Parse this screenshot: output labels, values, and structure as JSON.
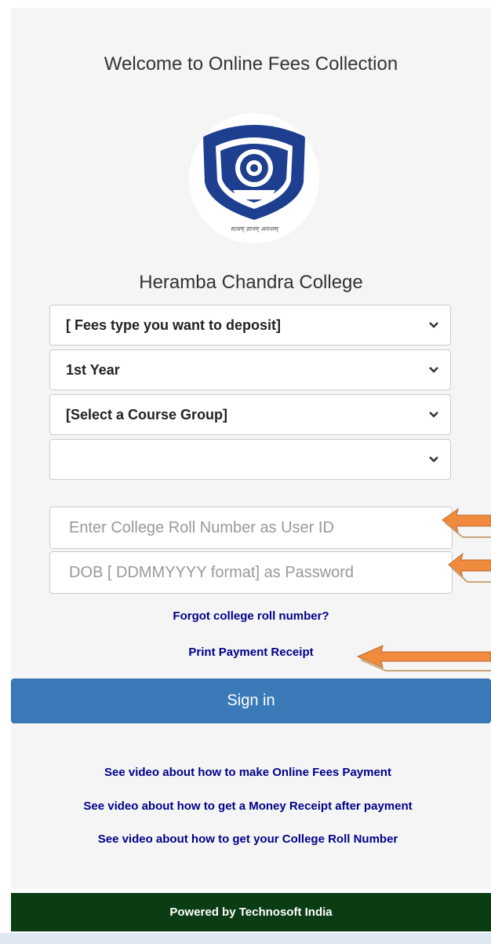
{
  "header": {
    "title": "Welcome to Online Fees Collection"
  },
  "logo": {
    "motto": "सत्यम् ज्ञानम् अनन्तम्"
  },
  "college": {
    "name": "Heramba Chandra College"
  },
  "selects": {
    "fees_type": "[ Fees type you want to deposit]",
    "year": "1st Year",
    "course_group": "[Select a Course Group]",
    "extra": ""
  },
  "login": {
    "user_id_placeholder": "Enter College Roll Number as User ID",
    "password_placeholder": "DOB [ DDMMYYYY format] as Password",
    "forgot_link": "Forgot college roll number?",
    "print_receipt_link": "Print Payment Receipt",
    "sign_in_label": "Sign in"
  },
  "videos": {
    "payment": "See video about how to make Online Fees Payment",
    "money_receipt": "See video about how to get a Money Receipt after payment",
    "roll_number": "See video about how to get your College Roll Number"
  },
  "footer": {
    "powered_by": "Powered by Technosoft India"
  },
  "colors": {
    "primary_button": "#3a7ab8",
    "link": "#00008b",
    "footer_bg": "#0b3d14",
    "annotation_arrow": "#f08a3c"
  },
  "icons": [
    "chevron-down-icon",
    "college-emblem-logo",
    "annotation-arrow"
  ]
}
